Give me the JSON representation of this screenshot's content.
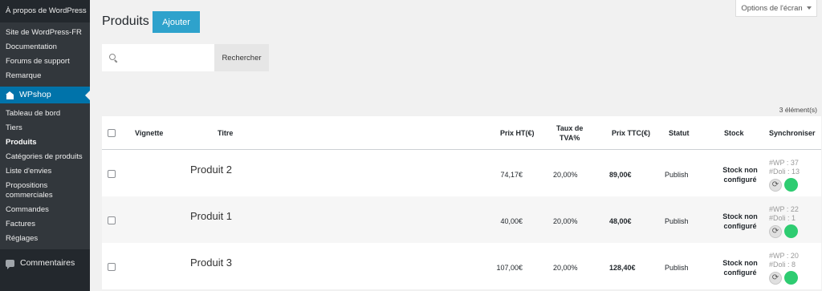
{
  "sidebar": {
    "about": "À propos de WordPress",
    "links": [
      "Site de WordPress-FR",
      "Documentation",
      "Forums de support",
      "Remarque"
    ],
    "active_menu": "WPshop",
    "submenu": [
      {
        "label": "Tableau de bord"
      },
      {
        "label": "Tiers"
      },
      {
        "label": "Produits"
      },
      {
        "label": "Catégories de produits"
      },
      {
        "label": "Liste d'envies"
      },
      {
        "label": "Propositions commerciales"
      },
      {
        "label": "Commandes"
      },
      {
        "label": "Factures"
      },
      {
        "label": "Réglages"
      }
    ],
    "comments": "Commentaires"
  },
  "screen_options": "Options de l'écran",
  "page": {
    "title": "Produits",
    "add_button": "Ajouter",
    "search_placeholder": "",
    "search_button": "Rechercher",
    "item_count": "3 élément(s)"
  },
  "table": {
    "headers": {
      "thumbnail": "Vignette",
      "title": "Titre",
      "price_ht": "Prix HT(€)",
      "tva_line1": "Taux de",
      "tva_line2": "TVA%",
      "price_ttc": "Prix TTC(€)",
      "status": "Statut",
      "stock": "Stock",
      "sync": "Synchroniser"
    },
    "rows": [
      {
        "name": "Produit 2",
        "ht": "74,17€",
        "tva": "20,00%",
        "ttc": "89,00€",
        "status": "Publish",
        "stock_1": "Stock non",
        "stock_2": "configuré",
        "wp": "#WP : 37",
        "doli": "#Doli : 13"
      },
      {
        "name": "Produit 1",
        "ht": "40,00€",
        "tva": "20,00%",
        "ttc": "48,00€",
        "status": "Publish",
        "stock_1": "Stock non",
        "stock_2": "configuré",
        "wp": "#WP : 22",
        "doli": "#Doli : 1"
      },
      {
        "name": "Produit 3",
        "ht": "107,00€",
        "tva": "20,00%",
        "ttc": "128,40€",
        "status": "Publish",
        "stock_1": "Stock non",
        "stock_2": "configuré",
        "wp": "#WP : 20",
        "doli": "#Doli : 8"
      }
    ]
  },
  "colors": {
    "accent": "#0073aa",
    "button": "#2ea2cc",
    "sync_ok": "#2ecc71",
    "sidebar": "#23282d"
  }
}
